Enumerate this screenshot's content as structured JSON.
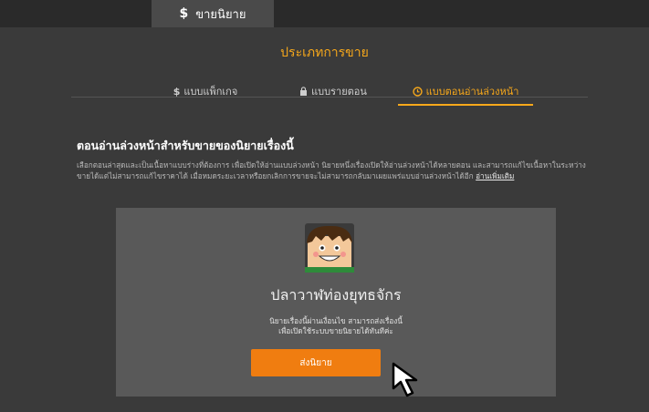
{
  "top_tab": {
    "icon": "dollar-icon",
    "label": "ขายนิยาย"
  },
  "section_title": "ประเภทการขาย",
  "tabs": [
    {
      "icon": "dollar-icon",
      "icon_text": "$",
      "label": "แบบแพ็กเกจ",
      "active": false
    },
    {
      "icon": "lock-icon",
      "icon_text": "",
      "label": "แบบรายตอน",
      "active": false
    },
    {
      "icon": "clock-icon",
      "icon_text": "",
      "label": "แบบตอนอ่านล่วงหน้า",
      "active": true
    }
  ],
  "heading": "ตอนอ่านล่วงหน้าสำหรับขายของนิยายเรื่องนี้",
  "description": "เลือกตอนล่าสุดและเป็นเนื้อหาแบบร่างที่ต้องการ เพื่อเปิดให้อ่านแบบล่วงหน้า นิยายหนึ่งเรื่องเปิดให้อ่านล่วงหน้าได้หลายตอน และสามารถแก้ไขเนื้อหาในระหว่างขายได้แต่ไม่สามารถแก้ไขราคาได้ เมื่อหมดระยะเวลาหรือยกเลิกการขายจะไม่สามารถกลับมาเผยแพร่แบบอ่านล่วงหน้าได้อีก",
  "read_more": "อ่านเพิ่มเติม",
  "card": {
    "novel_title": "ปลาวาฬท่องยุทธจักร",
    "note_line1": "นิยายเรื่องนี้ผ่านเงื่อนไข สามารถส่งเรื่องนี้",
    "note_line2": "เพื่อเปิดใช้ระบบขายนิยายได้ทันทีค่ะ",
    "submit_label": "ส่งนิยาย"
  },
  "colors": {
    "accent": "#f7a81b",
    "button": "#f07d10",
    "background": "#3a3a3a",
    "card": "#595959"
  }
}
